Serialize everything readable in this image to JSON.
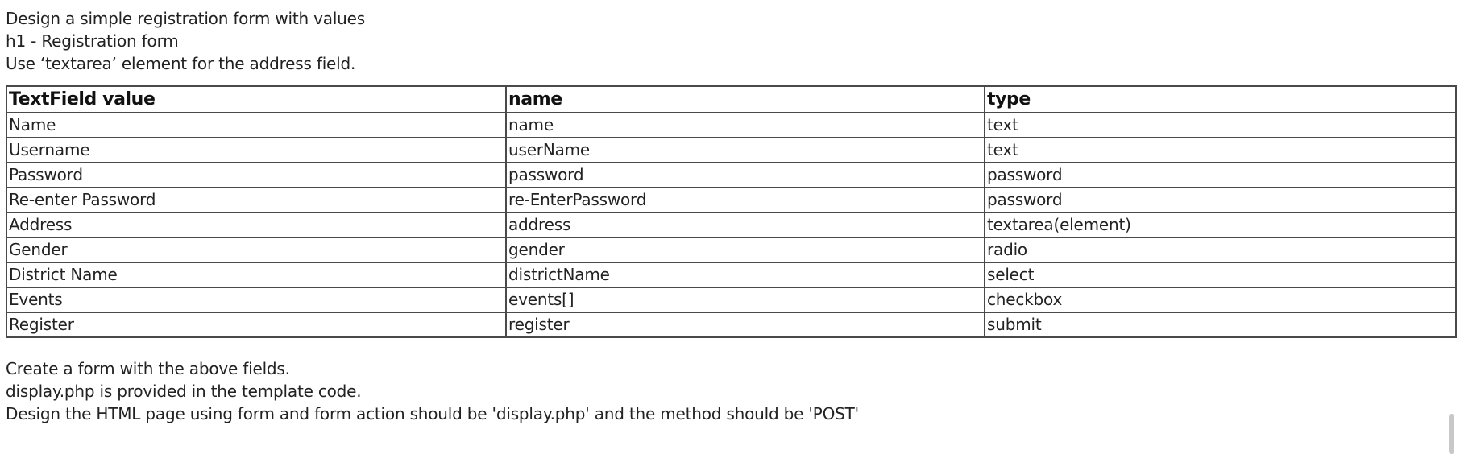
{
  "intro": {
    "line1": "Design a simple registration form with values",
    "line2": "h1 - Registration form",
    "line3": "Use ‘textarea’ element for the address field."
  },
  "table": {
    "headers": [
      "TextField value",
      "name",
      "type"
    ],
    "rows": [
      [
        "Name",
        "name",
        "text"
      ],
      [
        "Username",
        "userName",
        "text"
      ],
      [
        "Password",
        "password",
        "password"
      ],
      [
        "Re-enter Password",
        "re-EnterPassword",
        "password"
      ],
      [
        "Address",
        "address",
        "textarea(element)"
      ],
      [
        "Gender",
        "gender",
        "radio"
      ],
      [
        "District Name",
        "districtName",
        "select"
      ],
      [
        "Events",
        "events[]",
        "checkbox"
      ],
      [
        "Register",
        "register",
        "submit"
      ]
    ]
  },
  "outro": {
    "line1": "Create a form with the above fields.",
    "line2": "display.php is provided in the template code.",
    "line3": "Design the HTML page using form and form action should be 'display.php' and the method should be 'POST'"
  }
}
